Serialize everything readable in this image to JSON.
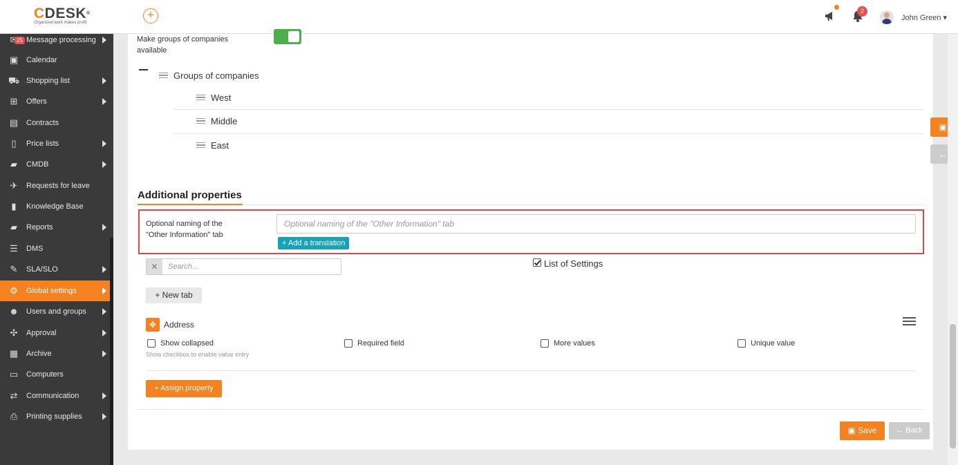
{
  "header": {
    "logo_text": "CDESK",
    "logo_tagline": "Organized work makes profit",
    "notifications_count": "2",
    "user_name": "John Green ▾"
  },
  "sidebar": {
    "message_badge": "25",
    "items": [
      {
        "label": "Message processing",
        "icon": "envelope-icon"
      },
      {
        "label": "Calendar",
        "icon": "calendar-icon"
      },
      {
        "label": "Shopping list",
        "icon": "cart-icon"
      },
      {
        "label": "Offers",
        "icon": "gift-icon"
      },
      {
        "label": "Contracts",
        "icon": "contract-icon"
      },
      {
        "label": "Price lists",
        "icon": "document-icon"
      },
      {
        "label": "CMDB",
        "icon": "folder-icon"
      },
      {
        "label": "Requests for leave",
        "icon": "plane-icon"
      },
      {
        "label": "Knowledge Base",
        "icon": "book-icon"
      },
      {
        "label": "Reports",
        "icon": "folder-icon"
      },
      {
        "label": "DMS",
        "icon": "database-icon"
      },
      {
        "label": "SLA/SLO",
        "icon": "wrench-icon"
      },
      {
        "label": "Global settings",
        "icon": "gears-icon"
      },
      {
        "label": "Users and groups",
        "icon": "users-icon"
      },
      {
        "label": "Approval",
        "icon": "arrows-icon"
      },
      {
        "label": "Archive",
        "icon": "archive-icon"
      },
      {
        "label": "Computers",
        "icon": "laptop-icon"
      },
      {
        "label": "Communication",
        "icon": "exchange-icon"
      },
      {
        "label": "Printing supplies",
        "icon": "printer-icon"
      }
    ]
  },
  "groups": {
    "make_available_label_1": "Make groups of companies",
    "make_available_label_2": "available",
    "make_available_on": true,
    "title": "Groups of companies",
    "items": [
      "West",
      "Middle",
      "East"
    ]
  },
  "additional": {
    "title": "Additional properties",
    "other_tab_label_1": "Optional naming of the",
    "other_tab_label_2": "\"Other Information\" tab",
    "other_tab_placeholder": "Optional naming of the \"Other Information\" tab",
    "add_translation": "+ Add a translation",
    "search_placeholder": "Search...",
    "list_of_settings": "List of Settings",
    "list_of_settings_checked": true,
    "new_tab": "+ New tab",
    "property_name": "Address",
    "show_collapsed": "Show collapsed",
    "show_collapsed_hint": "Show checkbox to enable value entry",
    "required_field": "Required field",
    "more_values": "More values",
    "unique_value": "Unique value",
    "assign_property": "+ Assign property"
  },
  "footer": {
    "save": "Save",
    "back": "Back"
  },
  "colors": {
    "accent": "#f58220",
    "sidebar_bg": "#3a3a3a",
    "toggle_on": "#4cae4c",
    "translate_btn": "#17a2b8",
    "highlight": "#e04848"
  }
}
